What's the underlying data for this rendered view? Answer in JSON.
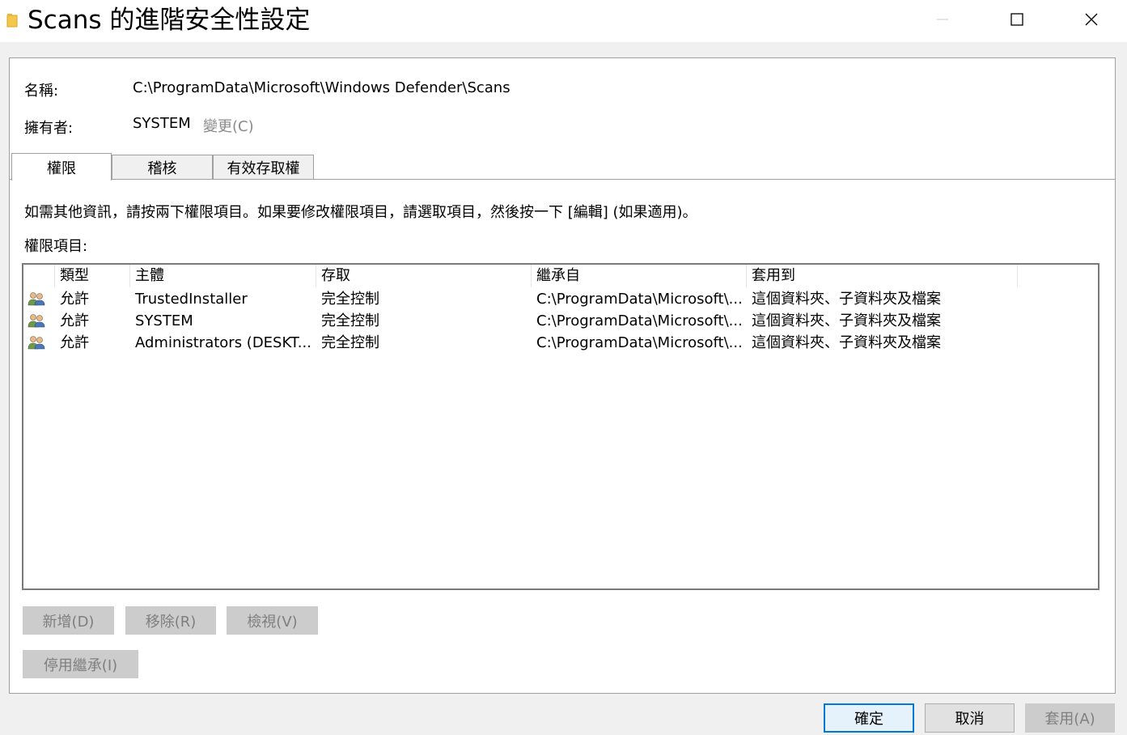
{
  "window": {
    "title": "Scans 的進階安全性設定",
    "folder_icon": "folder-icon",
    "controls": {
      "minimize": "minimize-icon",
      "maximize": "maximize-icon",
      "close": "close-icon"
    }
  },
  "info": {
    "name_label": "名稱:",
    "name_value": "C:\\ProgramData\\Microsoft\\Windows Defender\\Scans",
    "owner_label": "擁有者:",
    "owner_value": "SYSTEM",
    "change_link": "變更(C)"
  },
  "tabs": [
    {
      "label": "權限",
      "active": true
    },
    {
      "label": "稽核",
      "active": false
    },
    {
      "label": "有效存取權",
      "active": false
    }
  ],
  "hint": "如需其他資訊，請按兩下權限項目。如果要修改權限項目，請選取項目，然後按一下 [編輯] (如果適用)。",
  "entries_label": "權限項目:",
  "columns": [
    "類型",
    "主體",
    "存取",
    "繼承自",
    "套用到"
  ],
  "entries": [
    {
      "icon": "user-group-icon",
      "type": "允許",
      "principal": "TrustedInstaller",
      "access": "完全控制",
      "inherited_from": "C:\\ProgramData\\Microsoft\\...",
      "applies_to": "這個資料夾、子資料夾及檔案"
    },
    {
      "icon": "user-group-icon",
      "type": "允許",
      "principal": "SYSTEM",
      "access": "完全控制",
      "inherited_from": "C:\\ProgramData\\Microsoft\\...",
      "applies_to": "這個資料夾、子資料夾及檔案"
    },
    {
      "icon": "user-group-icon",
      "type": "允許",
      "principal": "Administrators (DESKT...",
      "access": "完全控制",
      "inherited_from": "C:\\ProgramData\\Microsoft\\...",
      "applies_to": "這個資料夾、子資料夾及檔案"
    }
  ],
  "action_buttons": {
    "add": "新增(D)",
    "remove": "移除(R)",
    "view": "檢視(V)",
    "disable_inheritance": "停用繼承(I)"
  },
  "dialog_buttons": {
    "ok": "確定",
    "cancel": "取消",
    "apply": "套用(A)"
  },
  "colors": {
    "accent": "#0078d7",
    "disabled_bg": "#cccccc",
    "disabled_text": "#7f7f7f",
    "link_gray": "#8a8a8a"
  }
}
